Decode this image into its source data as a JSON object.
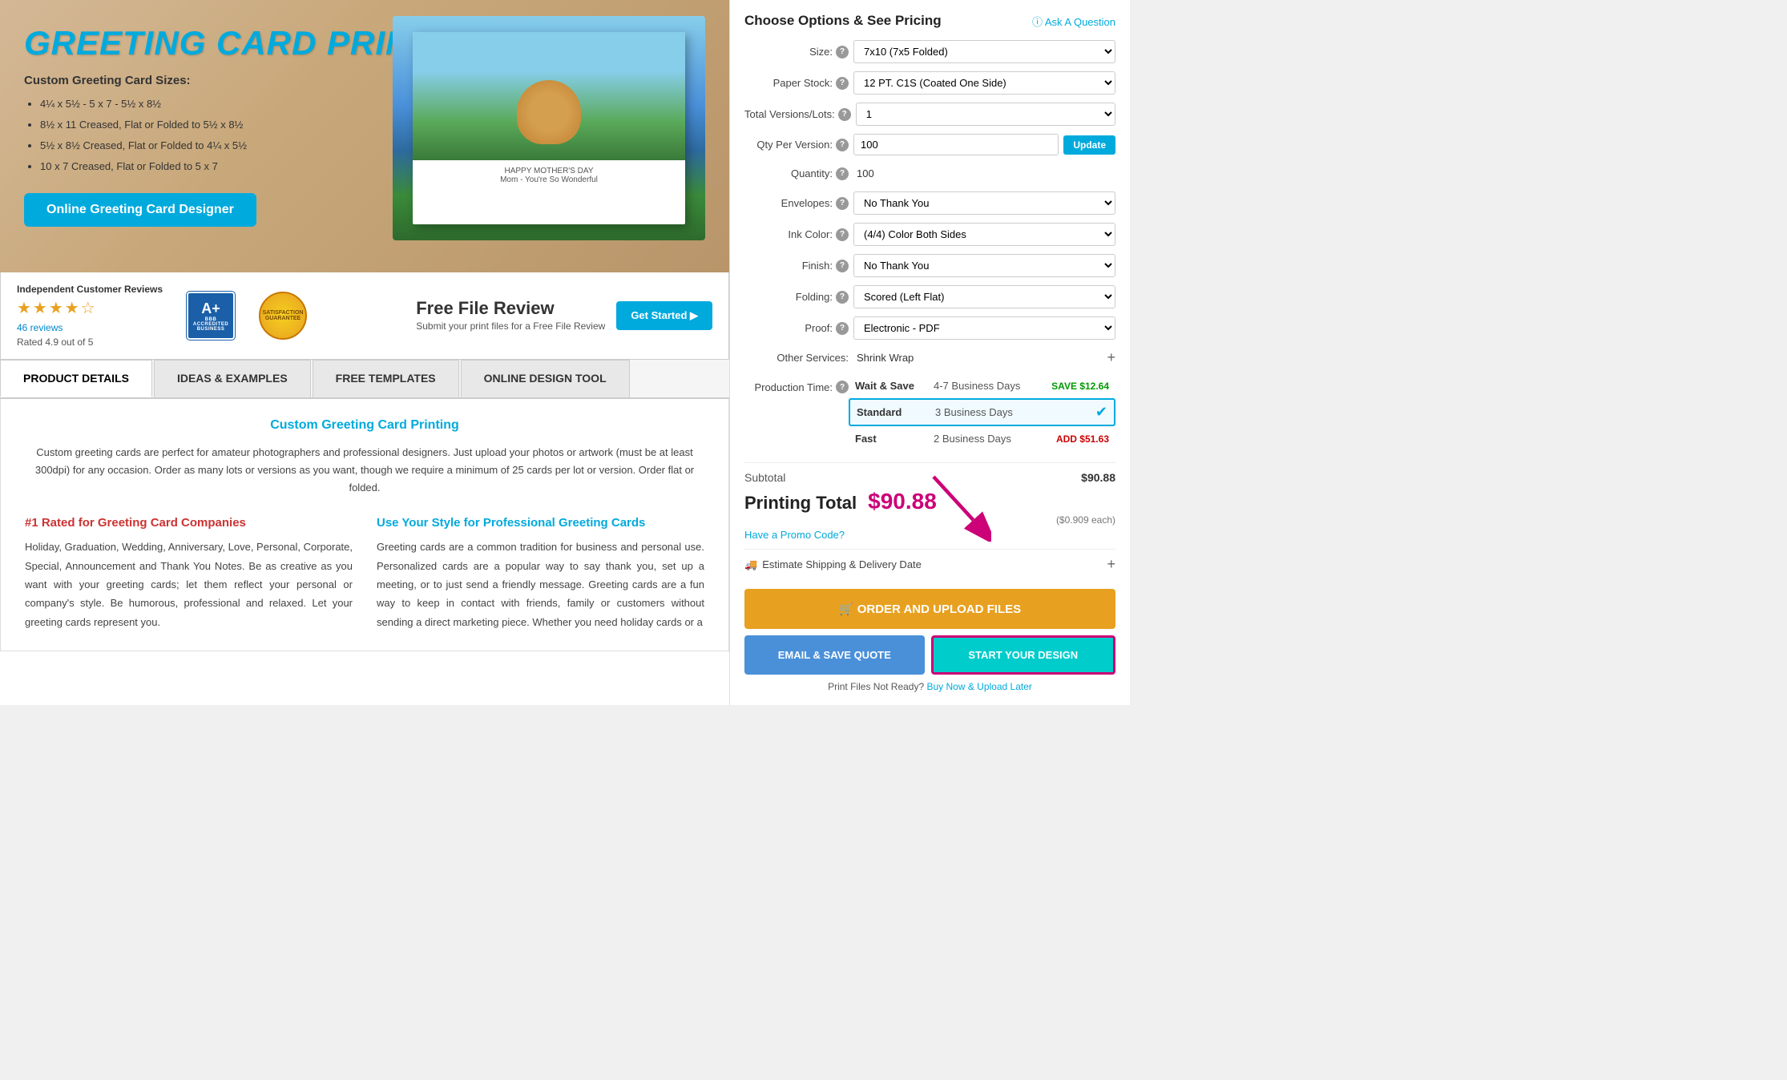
{
  "hero": {
    "title": "GREETING CARD PRINTING",
    "subtitle": "Custom Greeting Card Sizes:",
    "sizes": [
      "4¼ x 5½ - 5 x 7 - 5½ x 8½",
      "8½ x 11 Creased, Flat or Folded to 5½ x 8½",
      "5½ x 8½ Creased, Flat or Folded to 4¼ x 5½",
      "10 x 7 Creased, Flat or Folded to 5 x 7"
    ],
    "designer_btn": "Online Greeting Card Designer"
  },
  "reviews": {
    "label": "Independent Customer Reviews",
    "stars": "★★★★☆",
    "count": "46 reviews",
    "rating": "Rated 4.9 out of 5",
    "bbb_ap": "A+",
    "bbb_label": "BBB\nACCREDITED\nBUSINESS",
    "satisfaction": "SATISFACTION\nGUARANTEE",
    "ffr_title": "Free File Review",
    "ffr_sub": "Submit your print files\nfor a Free File Review",
    "get_started": "Get Started ▶"
  },
  "tabs": [
    {
      "label": "PRODUCT DETAILS",
      "active": true
    },
    {
      "label": "IDEAS & EXAMPLES",
      "active": false
    },
    {
      "label": "FREE TEMPLATES",
      "active": false
    },
    {
      "label": "ONLINE DESIGN TOOL",
      "active": false
    }
  ],
  "content": {
    "heading": "Custom Greeting Card Printing",
    "intro": "Custom greeting cards are perfect for amateur photographers and professional designers. Just upload your photos or artwork (must be at least 300dpi) for any occasion. Order as many lots or versions as you want, though we require a minimum of 25 cards per lot or version. Order flat or folded.",
    "col1_heading": "#1 Rated for Greeting Card Companies",
    "col1_text": "Holiday, Graduation, Wedding, Anniversary, Love, Personal, Corporate, Special, Announcement and Thank You Notes. Be as creative as you want with your greeting cards; let them reflect your personal or company's style. Be humorous, professional and relaxed. Let your greeting cards represent you.",
    "col2_heading": "Use Your Style for Professional Greeting Cards",
    "col2_text": "Greeting cards are a common tradition for business and personal use. Personalized cards are a popular way to say thank you, set up a meeting, or to just send a friendly message. Greeting cards are a fun way to keep in contact with friends, family or customers without sending a direct marketing piece. Whether you need holiday cards or a"
  },
  "options_panel": {
    "title": "Choose Options & See Pricing",
    "ask_link": "ⓘ Ask A Question",
    "fields": [
      {
        "label": "Size:",
        "help": true,
        "value": "7x10 (7x5 Folded)",
        "type": "select"
      },
      {
        "label": "Paper Stock:",
        "help": true,
        "value": "12 PT. C1S (Coated One Side)",
        "type": "select"
      },
      {
        "label": "Total Versions/Lots:",
        "help": true,
        "value": "1",
        "type": "select"
      },
      {
        "label": "Qty Per Version:",
        "help": true,
        "value": "100",
        "type": "input_update"
      },
      {
        "label": "Quantity:",
        "help": true,
        "value": "100",
        "type": "static"
      },
      {
        "label": "Envelopes:",
        "help": true,
        "value": "No Thank You",
        "type": "select"
      },
      {
        "label": "Ink Color:",
        "help": true,
        "value": "(4/4) Color Both Sides",
        "type": "select"
      },
      {
        "label": "Finish:",
        "help": true,
        "value": "No Thank You",
        "type": "select"
      },
      {
        "label": "Folding:",
        "help": true,
        "value": "Scored (Left Flat)",
        "type": "select"
      },
      {
        "label": "Proof:",
        "help": true,
        "value": "Electronic - PDF",
        "type": "select"
      }
    ],
    "other_services": {
      "label": "Other Services:",
      "value": "Shrink Wrap",
      "plus": "+"
    },
    "production_time": {
      "label": "Production Time:",
      "help": true,
      "options": [
        {
          "name": "Wait & Save",
          "days": "4-7 Business Days",
          "price": "SAVE $12.64",
          "price_type": "save",
          "selected": false
        },
        {
          "name": "Standard",
          "days": "3 Business Days",
          "price": "",
          "price_type": "included",
          "selected": true
        },
        {
          "name": "Fast",
          "days": "2 Business Days",
          "price": "ADD $51.63",
          "price_type": "add",
          "selected": false
        }
      ]
    },
    "subtotal_label": "Subtotal",
    "subtotal_value": "$90.88",
    "printing_total_label": "Printing Total",
    "printing_total_value": "$90.88",
    "per_each": "($0.909 each)",
    "promo_link": "Have a Promo Code?",
    "shipping_label": "Estimate Shipping & Delivery Date",
    "order_btn": "🛒  ORDER AND UPLOAD FILES",
    "email_btn": "EMAIL & SAVE QUOTE",
    "start_design_btn": "START YOUR DESIGN",
    "upload_later_text": "Print Files Not Ready?",
    "upload_later_link": "Buy Now & Upload Later"
  }
}
